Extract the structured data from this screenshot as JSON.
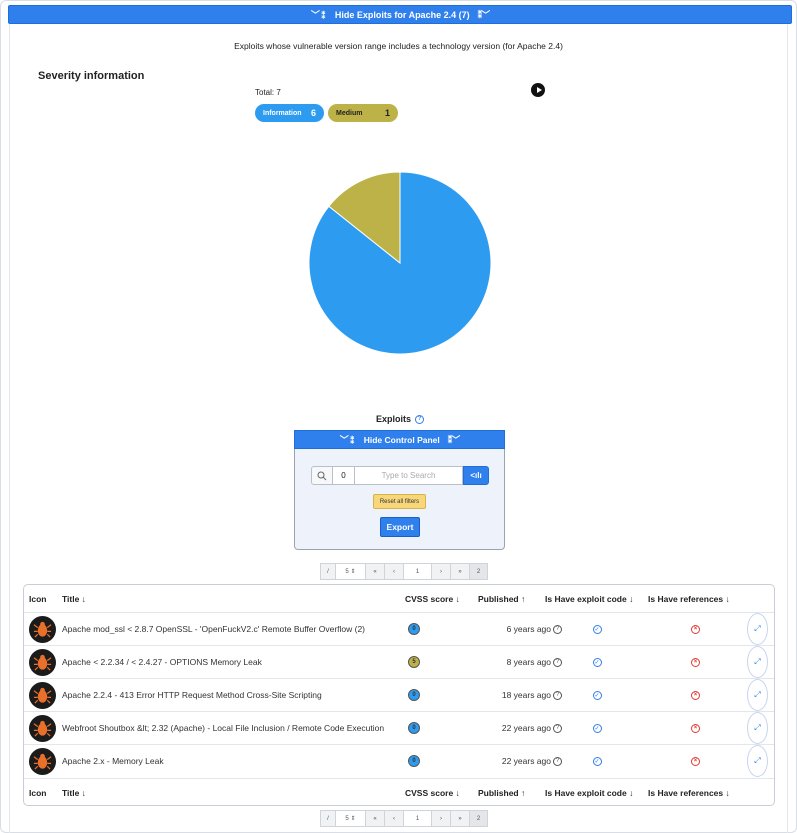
{
  "top_bar": {
    "label": "Hide Exploits for Apache 2.4 (7)",
    "icon_left": "collapse-chevrons-icon",
    "icon_right": "collapse-chevrons-icon"
  },
  "subtitle": "Exploits whose vulnerable version range includes a technology version (for Apache 2.4)",
  "severity": {
    "title": "Severity information",
    "total": "Total: 7",
    "pills": [
      {
        "label": "Information",
        "count": "6",
        "color": "#2d9cf0"
      },
      {
        "label": "Medium",
        "count": "1",
        "color": "#bdb247"
      }
    ]
  },
  "chart_data": {
    "type": "pie",
    "categories": [
      "Information",
      "Medium"
    ],
    "values": [
      6,
      1
    ],
    "colors": [
      "#2d9cf0",
      "#bdb247"
    ]
  },
  "exploits_label": "Exploits",
  "control_panel": {
    "label": "Hide Control Panel",
    "search_count": "0",
    "search_placeholder": "Type to Search",
    "filter_label": "<ılı",
    "reset_label": "Reset all filters",
    "export_label": "Export"
  },
  "pager": {
    "size": "5",
    "current": "1",
    "total": "2"
  },
  "table": {
    "headers": {
      "icon": "Icon",
      "title": "Title ↓",
      "cvss": "CVSS score ↓",
      "published": "Published ↑",
      "exploit": "Is Have exploit code ↓",
      "references": "Is Have references ↓"
    },
    "rows": [
      {
        "title": "Apache mod_ssl < 2.8.7 OpenSSL - 'OpenFuckV2.c' Remote Buffer Overflow (2)",
        "score": "0",
        "published": "6 years ago"
      },
      {
        "title": "Apache < 2.2.34 / < 2.4.27 - OPTIONS Memory Leak",
        "score": "5",
        "published": "8 years ago"
      },
      {
        "title": "Apache 2.2.4 - 413 Error HTTP Request Method Cross-Site Scripting",
        "score": "0",
        "published": "18 years ago"
      },
      {
        "title": "Webfroot Shoutbox &lt; 2.32 (Apache) - Local File Inclusion / Remote Code Execution",
        "score": "0",
        "published": "22 years ago"
      },
      {
        "title": "Apache 2.x - Memory Leak",
        "score": "0",
        "published": "22 years ago"
      }
    ]
  },
  "colors": {
    "accent": "#2f80ed",
    "info": "#2d9cf0",
    "medium": "#bdb247",
    "danger": "#e53935"
  }
}
